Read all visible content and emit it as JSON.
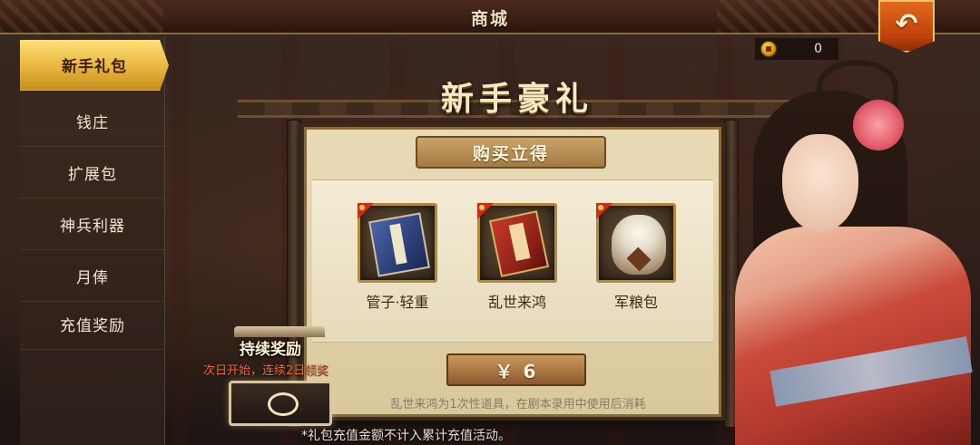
{
  "header": {
    "title": "商城",
    "back_icon": "return-arrow-icon"
  },
  "currency": {
    "icon": "gold-coin-icon",
    "value": "0"
  },
  "sidebar": {
    "items": [
      {
        "label": "新手礼包",
        "active": true
      },
      {
        "label": "钱庄",
        "active": false
      },
      {
        "label": "扩展包",
        "active": false
      },
      {
        "label": "神兵利器",
        "active": false
      },
      {
        "label": "月俸",
        "active": false
      },
      {
        "label": "充值奖励",
        "active": false
      }
    ]
  },
  "gift": {
    "banner_title": "新手豪礼",
    "header": "购买立得",
    "items": [
      {
        "label": "管子·轻重",
        "icon": "blue-book-icon"
      },
      {
        "label": "乱世来鸿",
        "icon": "red-book-icon"
      },
      {
        "label": "军粮包",
        "icon": "grain-sack-icon"
      }
    ],
    "price_label": "￥ 6",
    "note": "乱世来鸿为1次性道具，在剧本录用中使用后消耗"
  },
  "continuous_reward": {
    "title": "持续奖励",
    "subtitle": "次日开始，连续2日领奖"
  },
  "footer": {
    "note": "*礼包充值金额不计入累计充值活动。"
  },
  "colors": {
    "accent_gold": "#e8b63c",
    "back_button": "#c2410c",
    "highlight_text": "#ff6a2a"
  }
}
